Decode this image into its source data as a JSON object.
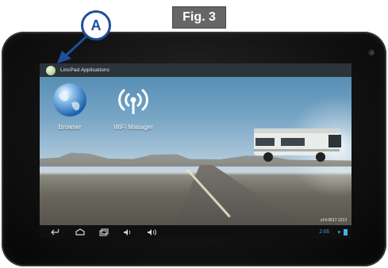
{
  "figure": {
    "label": "Fig. 3"
  },
  "callout": {
    "label": "A"
  },
  "statusbar": {
    "title": "LincPad Applications",
    "icon": "lincpad-app-icon"
  },
  "apps": [
    {
      "label": "Browser",
      "icon": "globe-icon"
    },
    {
      "label": "WiFi Manager",
      "icon": "wifi-antenna-icon"
    }
  ],
  "navbar": {
    "buttons": [
      "back-icon",
      "home-icon",
      "recent-apps-icon",
      "volume-down-icon",
      "volume-up-icon"
    ],
    "time": "2:05",
    "wifi_icon": "wifi-icon",
    "battery_icon": "battery-icon"
  },
  "version": "v14.0617.1213",
  "colors": {
    "accent": "#3fb3e5",
    "callout": "#1d4f9b"
  }
}
